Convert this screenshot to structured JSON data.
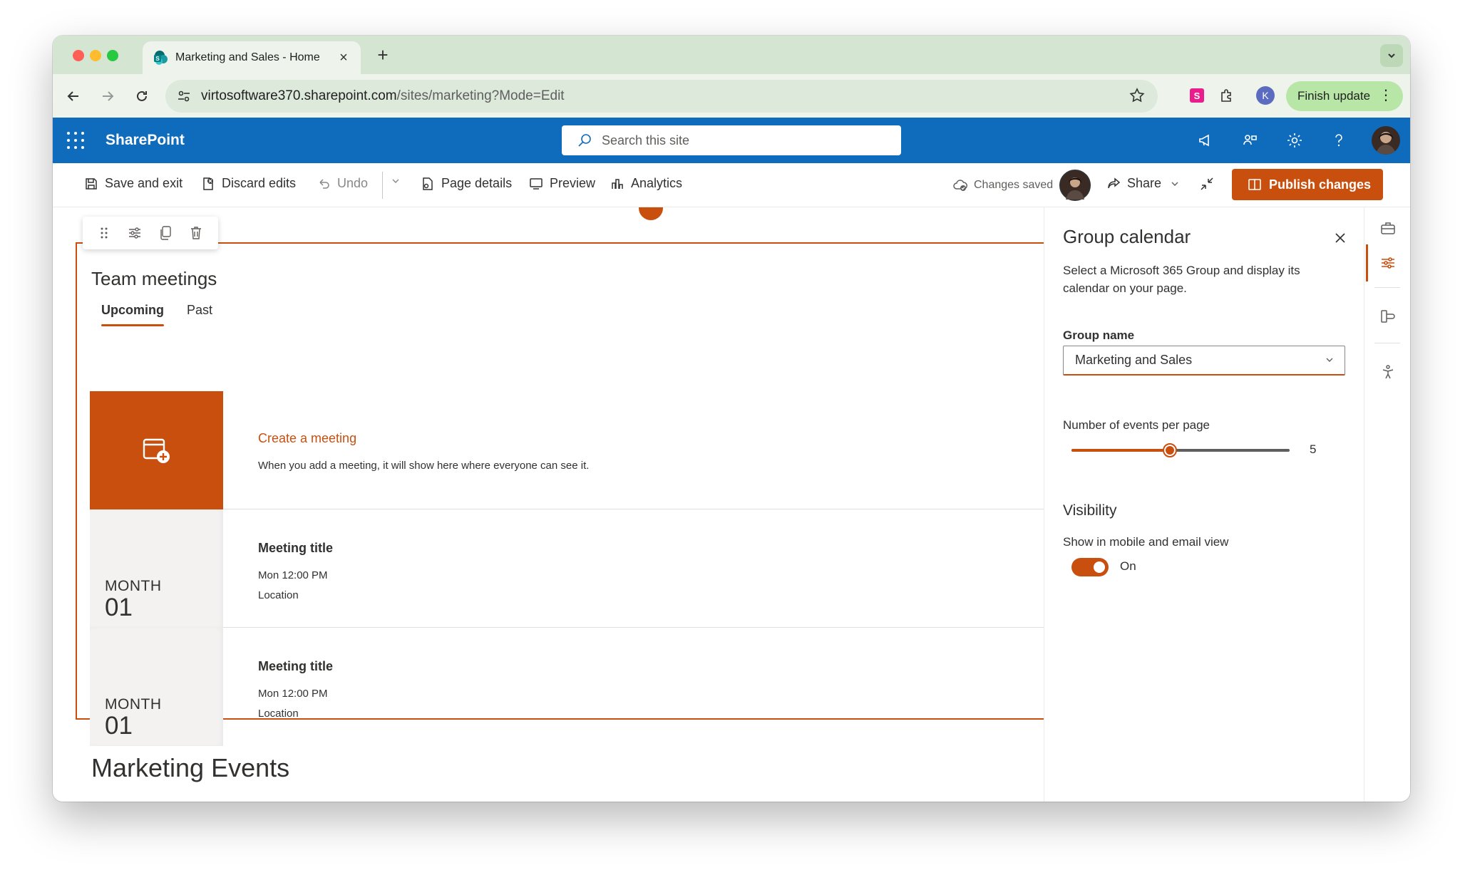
{
  "browser": {
    "tab_title": "Marketing and Sales - Home",
    "url_host": "virtosoftware370.sharepoint.com",
    "url_path": "/sites/marketing?Mode=Edit",
    "profile_initial": "K",
    "finish_update_label": "Finish update"
  },
  "sharepoint": {
    "brand": "SharePoint",
    "search_placeholder": "Search this site"
  },
  "commandbar": {
    "save_exit": "Save and exit",
    "discard": "Discard edits",
    "undo": "Undo",
    "page_details": "Page details",
    "preview": "Preview",
    "analytics": "Analytics",
    "status": "Changes saved",
    "share": "Share",
    "publish": "Publish changes"
  },
  "webpart": {
    "title": "Team meetings",
    "tabs": [
      "Upcoming",
      "Past"
    ],
    "create": {
      "title": "Create a meeting",
      "description": "When you add a meeting, it will show here where everyone can see it."
    },
    "events": [
      {
        "month": "MONTH",
        "day": "01",
        "title": "Meeting title",
        "time": "Mon 12:00 PM",
        "location": "Location"
      },
      {
        "month": "MONTH",
        "day": "01",
        "title": "Meeting title",
        "time": "Mon 12:00 PM",
        "location": "Location"
      }
    ]
  },
  "next_section_title": "Marketing Events",
  "property_pane": {
    "title": "Group calendar",
    "description": "Select a Microsoft 365 Group and display its calendar on your page.",
    "group_name_label": "Group name",
    "group_name_value": "Marketing and Sales",
    "events_per_page_label": "Number of events per page",
    "events_per_page_value": "5",
    "events_per_page_fraction": 0.45,
    "visibility_heading": "Visibility",
    "visibility_label": "Show in mobile and email view",
    "visibility_state": "On"
  },
  "colors": {
    "accent": "#c94f0f",
    "header_blue": "#0f6cbd",
    "chrome_green": "#d4e5d1"
  }
}
